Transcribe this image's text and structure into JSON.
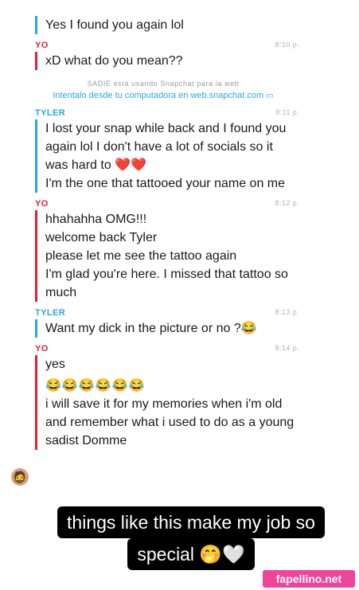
{
  "messages": [
    {
      "sender": "",
      "time": "",
      "text": "Yes I found you again lol"
    },
    {
      "sender": "YO",
      "time": "8:10 p.",
      "text": "xD what do you mean??"
    },
    {
      "sender": "TYLER",
      "time": "8:11 p.",
      "text": "I lost your snap while back and I found you again lol I don't have a lot of socials so it was hard to ❤️❤️\nI'm the one that tattooed your name on me"
    },
    {
      "sender": "YO",
      "time": "8:12 p.",
      "text": "hhahahha OMG!!!\nwelcome back Tyler\nplease let me see the tattoo again\nI'm glad you're here. I missed that tattoo so much"
    },
    {
      "sender": "TYLER",
      "time": "8:13 p.",
      "text": "Want my dick in the picture or no ?😂"
    },
    {
      "sender": "YO",
      "time": "8:14 p.",
      "text": "yes",
      "emojis": "😂😂😂😂😂😂",
      "text2": "i will save it for my memories when i'm old and remember what i used to do as a young sadist Domme"
    }
  ],
  "notice": {
    "line1": "SADIE está usando Snapchat para la web",
    "line2": "Intentalo desde tu computadora en web.snapchat.com",
    "icon": "monitor-icon"
  },
  "avatar_icon": "bitmoji-icon",
  "caption": {
    "line1": "things like this make my job so",
    "line2": "special 🤭🤍"
  },
  "watermark": "fapellino.net",
  "colors": {
    "tyler": "#27a7e7",
    "yo": "#e21f36",
    "watermark": "#f0449a"
  }
}
